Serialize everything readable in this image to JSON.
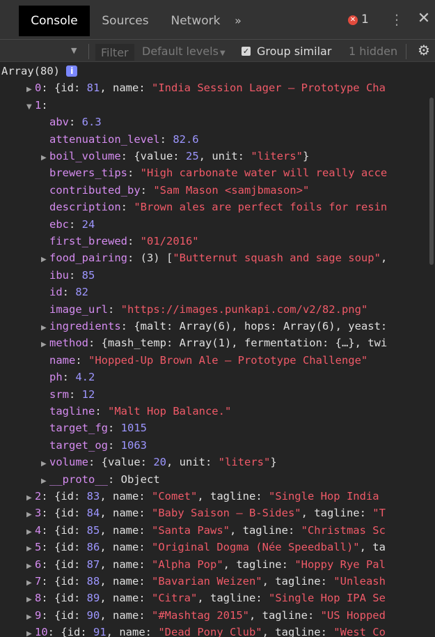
{
  "tabs": {
    "console": "Console",
    "sources": "Sources",
    "network": "Network",
    "more": "»"
  },
  "errors": {
    "count": "1"
  },
  "filterbar": {
    "filter_placeholder": "Filter",
    "levels": "Default levels",
    "group_similar": "Group similar",
    "hidden": "1 hidden"
  },
  "colors": {
    "key": "#d58cf0",
    "number": "#9d96ff",
    "string": "#f05a68",
    "plain": "#e0e0e0"
  },
  "console": {
    "lines": [
      {
        "indent": 0,
        "tri": "down",
        "segs": [
          [
            "p",
            "Array(80) "
          ]
        ],
        "info": true
      },
      {
        "indent": 1,
        "tri": "right",
        "segs": [
          [
            "k",
            "0"
          ],
          [
            "p",
            ": {id: "
          ],
          [
            "v",
            "81"
          ],
          [
            "p",
            ", name: "
          ],
          [
            "s",
            "\"India Session Lager – Prototype Cha"
          ]
        ]
      },
      {
        "indent": 1,
        "tri": "down",
        "segs": [
          [
            "k",
            "1"
          ],
          [
            "p",
            ":"
          ]
        ]
      },
      {
        "indent": 2,
        "tri": "",
        "segs": [
          [
            "k",
            "abv"
          ],
          [
            "p",
            ": "
          ],
          [
            "v",
            "6.3"
          ]
        ]
      },
      {
        "indent": 2,
        "tri": "",
        "segs": [
          [
            "k",
            "attenuation_level"
          ],
          [
            "p",
            ": "
          ],
          [
            "v",
            "82.6"
          ]
        ]
      },
      {
        "indent": 2,
        "tri": "right",
        "segs": [
          [
            "k",
            "boil_volume"
          ],
          [
            "p",
            ": {value: "
          ],
          [
            "v",
            "25"
          ],
          [
            "p",
            ", unit: "
          ],
          [
            "s",
            "\"liters\""
          ],
          [
            "p",
            "}"
          ]
        ]
      },
      {
        "indent": 2,
        "tri": "",
        "segs": [
          [
            "k",
            "brewers_tips"
          ],
          [
            "p",
            ": "
          ],
          [
            "s",
            "\"High carbonate water will really acce"
          ]
        ]
      },
      {
        "indent": 2,
        "tri": "",
        "segs": [
          [
            "k",
            "contributed_by"
          ],
          [
            "p",
            ": "
          ],
          [
            "s",
            "\"Sam Mason <samjbmason>\""
          ]
        ]
      },
      {
        "indent": 2,
        "tri": "",
        "segs": [
          [
            "k",
            "description"
          ],
          [
            "p",
            ": "
          ],
          [
            "s",
            "\"Brown ales are perfect foils for resin"
          ]
        ]
      },
      {
        "indent": 2,
        "tri": "",
        "segs": [
          [
            "k",
            "ebc"
          ],
          [
            "p",
            ": "
          ],
          [
            "v",
            "24"
          ]
        ]
      },
      {
        "indent": 2,
        "tri": "",
        "segs": [
          [
            "k",
            "first_brewed"
          ],
          [
            "p",
            ": "
          ],
          [
            "s",
            "\"01/2016\""
          ]
        ]
      },
      {
        "indent": 2,
        "tri": "right",
        "segs": [
          [
            "k",
            "food_pairing"
          ],
          [
            "p",
            ": (3) ["
          ],
          [
            "s",
            "\"Butternut squash and sage soup\""
          ],
          [
            "p",
            ","
          ]
        ]
      },
      {
        "indent": 2,
        "tri": "",
        "segs": [
          [
            "k",
            "ibu"
          ],
          [
            "p",
            ": "
          ],
          [
            "v",
            "85"
          ]
        ]
      },
      {
        "indent": 2,
        "tri": "",
        "segs": [
          [
            "k",
            "id"
          ],
          [
            "p",
            ": "
          ],
          [
            "v",
            "82"
          ]
        ]
      },
      {
        "indent": 2,
        "tri": "",
        "segs": [
          [
            "k",
            "image_url"
          ],
          [
            "p",
            ": "
          ],
          [
            "s",
            "\"https://images.punkapi.com/v2/82.png\""
          ]
        ]
      },
      {
        "indent": 2,
        "tri": "right",
        "segs": [
          [
            "k",
            "ingredients"
          ],
          [
            "p",
            ": {malt: Array(6), hops: Array(6), yeast:"
          ]
        ]
      },
      {
        "indent": 2,
        "tri": "right",
        "segs": [
          [
            "k",
            "method"
          ],
          [
            "p",
            ": {mash_temp: Array(1), fermentation: {…}, twi"
          ]
        ]
      },
      {
        "indent": 2,
        "tri": "",
        "segs": [
          [
            "k",
            "name"
          ],
          [
            "p",
            ": "
          ],
          [
            "s",
            "\"Hopped-Up Brown Ale – Prototype Challenge\""
          ]
        ]
      },
      {
        "indent": 2,
        "tri": "",
        "segs": [
          [
            "k",
            "ph"
          ],
          [
            "p",
            ": "
          ],
          [
            "v",
            "4.2"
          ]
        ]
      },
      {
        "indent": 2,
        "tri": "",
        "segs": [
          [
            "k",
            "srm"
          ],
          [
            "p",
            ": "
          ],
          [
            "v",
            "12"
          ]
        ]
      },
      {
        "indent": 2,
        "tri": "",
        "segs": [
          [
            "k",
            "tagline"
          ],
          [
            "p",
            ": "
          ],
          [
            "s",
            "\"Malt Hop Balance.\""
          ]
        ]
      },
      {
        "indent": 2,
        "tri": "",
        "segs": [
          [
            "k",
            "target_fg"
          ],
          [
            "p",
            ": "
          ],
          [
            "v",
            "1015"
          ]
        ]
      },
      {
        "indent": 2,
        "tri": "",
        "segs": [
          [
            "k",
            "target_og"
          ],
          [
            "p",
            ": "
          ],
          [
            "v",
            "1063"
          ]
        ]
      },
      {
        "indent": 2,
        "tri": "right",
        "segs": [
          [
            "k",
            "volume"
          ],
          [
            "p",
            ": {value: "
          ],
          [
            "v",
            "20"
          ],
          [
            "p",
            ", unit: "
          ],
          [
            "s",
            "\"liters\""
          ],
          [
            "p",
            "}"
          ]
        ]
      },
      {
        "indent": 2,
        "tri": "right",
        "segs": [
          [
            "k",
            "__proto__"
          ],
          [
            "p",
            ": Object"
          ]
        ]
      },
      {
        "indent": 1,
        "tri": "right",
        "segs": [
          [
            "k",
            "2"
          ],
          [
            "p",
            ": {id: "
          ],
          [
            "v",
            "83"
          ],
          [
            "p",
            ", name: "
          ],
          [
            "s",
            "\"Comet\""
          ],
          [
            "p",
            ", tagline: "
          ],
          [
            "s",
            "\"Single Hop India"
          ]
        ]
      },
      {
        "indent": 1,
        "tri": "right",
        "segs": [
          [
            "k",
            "3"
          ],
          [
            "p",
            ": {id: "
          ],
          [
            "v",
            "84"
          ],
          [
            "p",
            ", name: "
          ],
          [
            "s",
            "\"Baby Saison – B-Sides\""
          ],
          [
            "p",
            ", tagline: "
          ],
          [
            "s",
            "\"T"
          ]
        ]
      },
      {
        "indent": 1,
        "tri": "right",
        "segs": [
          [
            "k",
            "4"
          ],
          [
            "p",
            ": {id: "
          ],
          [
            "v",
            "85"
          ],
          [
            "p",
            ", name: "
          ],
          [
            "s",
            "\"Santa Paws\""
          ],
          [
            "p",
            ", tagline: "
          ],
          [
            "s",
            "\"Christmas Sc"
          ]
        ]
      },
      {
        "indent": 1,
        "tri": "right",
        "segs": [
          [
            "k",
            "5"
          ],
          [
            "p",
            ": {id: "
          ],
          [
            "v",
            "86"
          ],
          [
            "p",
            ", name: "
          ],
          [
            "s",
            "\"Original Dogma (Née Speedball)\""
          ],
          [
            "p",
            ", ta"
          ]
        ]
      },
      {
        "indent": 1,
        "tri": "right",
        "segs": [
          [
            "k",
            "6"
          ],
          [
            "p",
            ": {id: "
          ],
          [
            "v",
            "87"
          ],
          [
            "p",
            ", name: "
          ],
          [
            "s",
            "\"Alpha Pop\""
          ],
          [
            "p",
            ", tagline: "
          ],
          [
            "s",
            "\"Hoppy Rye Pal"
          ]
        ]
      },
      {
        "indent": 1,
        "tri": "right",
        "segs": [
          [
            "k",
            "7"
          ],
          [
            "p",
            ": {id: "
          ],
          [
            "v",
            "88"
          ],
          [
            "p",
            ", name: "
          ],
          [
            "s",
            "\"Bavarian Weizen\""
          ],
          [
            "p",
            ", tagline: "
          ],
          [
            "s",
            "\"Unleash"
          ]
        ]
      },
      {
        "indent": 1,
        "tri": "right",
        "segs": [
          [
            "k",
            "8"
          ],
          [
            "p",
            ": {id: "
          ],
          [
            "v",
            "89"
          ],
          [
            "p",
            ", name: "
          ],
          [
            "s",
            "\"Citra\""
          ],
          [
            "p",
            ", tagline: "
          ],
          [
            "s",
            "\"Single Hop IPA Se"
          ]
        ]
      },
      {
        "indent": 1,
        "tri": "right",
        "segs": [
          [
            "k",
            "9"
          ],
          [
            "p",
            ": {id: "
          ],
          [
            "v",
            "90"
          ],
          [
            "p",
            ", name: "
          ],
          [
            "s",
            "\"#Mashtag 2015\""
          ],
          [
            "p",
            ", tagline: "
          ],
          [
            "s",
            "\"US Hopped"
          ]
        ]
      },
      {
        "indent": 1,
        "tri": "right",
        "segs": [
          [
            "k",
            "10"
          ],
          [
            "p",
            ": {id: "
          ],
          [
            "v",
            "91"
          ],
          [
            "p",
            ", name: "
          ],
          [
            "s",
            "\"Dead Pony Club\""
          ],
          [
            "p",
            ", tagline: "
          ],
          [
            "s",
            "\"West Co"
          ]
        ]
      }
    ]
  }
}
